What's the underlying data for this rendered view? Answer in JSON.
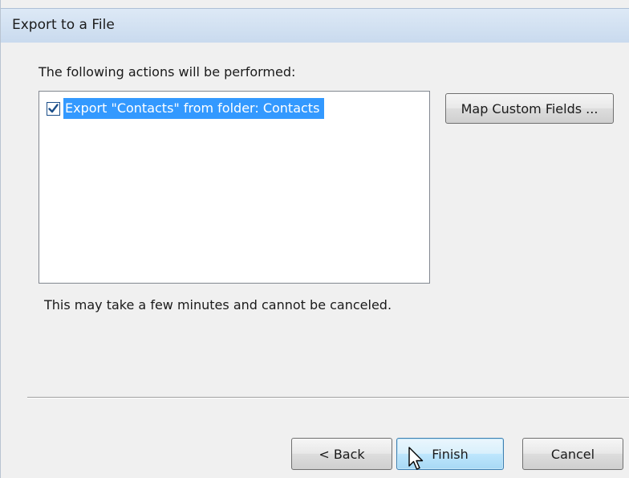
{
  "window": {
    "title": "Export to a File"
  },
  "main": {
    "instruction": "The following actions will be performed:",
    "actions": [
      {
        "label": "Export \"Contacts\" from folder: Contacts",
        "checked": true,
        "selected": true
      }
    ],
    "map_fields_label": "Map Custom Fields ...",
    "note": "This may take a few minutes and cannot be canceled."
  },
  "footer": {
    "back_label": "< Back",
    "finish_label": "Finish",
    "cancel_label": "Cancel"
  },
  "colors": {
    "selection": "#3399ff",
    "titlebar": "#c9daee"
  },
  "icons": {
    "checkbox": "checkbox-checked-icon",
    "cursor": "arrow-cursor-icon"
  }
}
